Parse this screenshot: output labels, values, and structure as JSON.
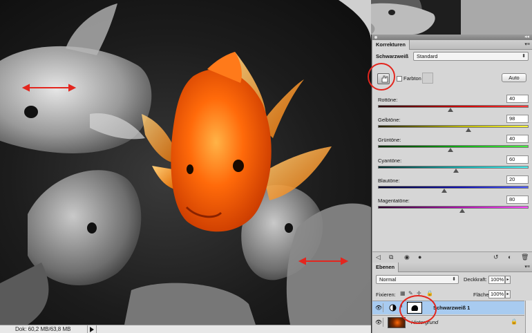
{
  "status": {
    "doc_size": "Dok: 60,2 MB/63,8 MB"
  },
  "adjustments": {
    "tab_label": "Korrekturen",
    "preset_label": "Schwarzweiß",
    "preset_value": "Standard",
    "tint_label": "Farbton",
    "auto_label": "Auto",
    "sliders": [
      {
        "label": "Rottöne:",
        "value": "40",
        "fraction": 0.48,
        "gradient": "linear-gradient(90deg,#2a0000,#d10000 55%,#ff3a3a)"
      },
      {
        "label": "Gelbtöne:",
        "value": "98",
        "fraction": 0.6,
        "gradient": "linear-gradient(90deg,#262200,#b9b400 55%,#fffb3a)"
      },
      {
        "label": "Grüntöne:",
        "value": "40",
        "fraction": 0.48,
        "gradient": "linear-gradient(90deg,#002a00,#12b015 55%,#48f040)"
      },
      {
        "label": "Cyantöne:",
        "value": "60",
        "fraction": 0.52,
        "gradient": "linear-gradient(90deg,#002a2a,#10b0b0 55%,#45f5f5)"
      },
      {
        "label": "Blautöne:",
        "value": "20",
        "fraction": 0.44,
        "gradient": "linear-gradient(90deg,#00002a,#1010b5 55%,#4b5bff)"
      },
      {
        "label": "Magentatöne:",
        "value": "80",
        "fraction": 0.56,
        "gradient": "linear-gradient(90deg,#2a002a,#b010b0 55%,#ff4bff)"
      }
    ]
  },
  "layers": {
    "tab_label": "Ebenen",
    "blend_mode": "Normal",
    "opacity_label": "Deckkraft:",
    "opacity_value": "100%",
    "lock_label": "Fixieren:",
    "fill_label": "Fläche:",
    "fill_value": "100%",
    "items": [
      {
        "name": "Schwarzweiß 1",
        "selected": true
      },
      {
        "name": "Hintergrund",
        "selected": false
      }
    ]
  },
  "colors": {
    "annotation": "#e3261e",
    "selection": "#a8cbf0",
    "panel_bg": "#d6d6d6"
  }
}
